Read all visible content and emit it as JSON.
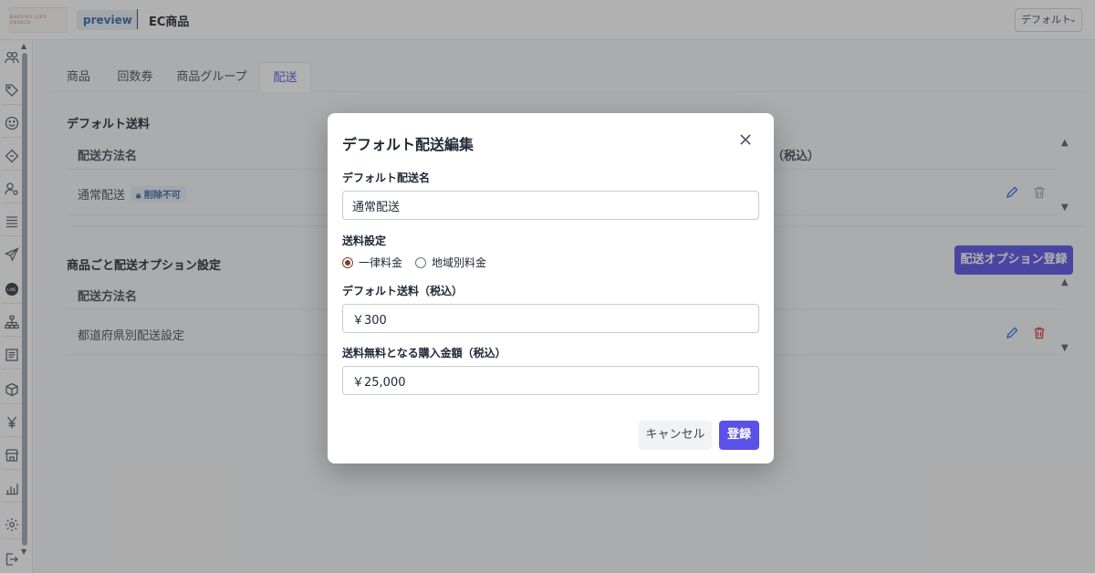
{
  "header": {
    "logo_text": "KAKURU LIFE DESIGN",
    "env_badge": "preview",
    "app_title": "EC商品",
    "store_select": "デフォルト"
  },
  "tabs": [
    {
      "label": "商品"
    },
    {
      "label": "回数券"
    },
    {
      "label": "商品グループ"
    },
    {
      "label": "配送",
      "active": true
    }
  ],
  "default_shipping": {
    "title": "デフォルト送料",
    "col_name": "配送方法名",
    "col_fee_suffix": "（税込）",
    "row_name": "通常配送",
    "row_badge": "削除不可"
  },
  "product_options": {
    "title": "商品ごと配送オプション設定",
    "col_name": "配送方法名",
    "row_name": "都道府県別配送設定",
    "register_button": "配送オプション登録"
  },
  "modal": {
    "title": "デフォルト配送編集",
    "name_label": "デフォルト配送名",
    "name_value": "通常配送",
    "fee_setting_label": "送料設定",
    "radio_flat": "一律料金",
    "radio_regional": "地域別料金",
    "selected_option": "一律料金",
    "fee_label": "デフォルト送料（税込）",
    "fee_value": "￥300",
    "free_label": "送料無料となる購入金額（税込）",
    "free_value": "￥25,000",
    "cancel": "キャンセル",
    "submit": "登録"
  },
  "colors": {
    "accent": "#4f46e5",
    "delete_red": "#dc2626",
    "edit_blue": "#2563eb"
  }
}
